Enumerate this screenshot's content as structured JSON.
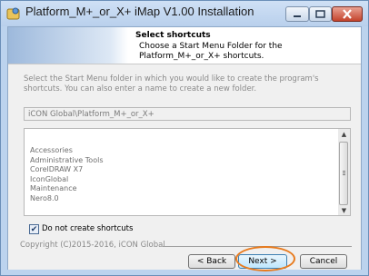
{
  "window": {
    "title": "Platform_M+_or_X+ iMap V1.00 Installation",
    "controls": {
      "minimize": "minimize",
      "maximize": "maximize",
      "close": "close"
    }
  },
  "header": {
    "title": "Select shortcuts",
    "subtitle": "Choose a Start Menu Folder for the Platform_M+_or_X+ shortcuts."
  },
  "content": {
    "description": "Select the Start Menu folder in which you would like to create the program's shortcuts. You can also enter a name to create a new folder.",
    "folder_value": "iCON Global\\Platform_M+_or_X+",
    "folders": [
      "Accessories",
      "Administrative Tools",
      "CorelDRAW X7",
      "IconGlobal",
      "Maintenance",
      "Nero8.0"
    ],
    "checkbox": {
      "label": "Do not create shortcuts",
      "checked": true
    }
  },
  "footer": {
    "copyright": "Copyright (C)2015-2016, iCON Global",
    "buttons": {
      "back": "< Back",
      "next": "Next >",
      "cancel": "Cancel"
    }
  },
  "colors": {
    "highlight": "#e87b1e",
    "titlebar": "#bcd3ee",
    "close": "#c4432c"
  }
}
